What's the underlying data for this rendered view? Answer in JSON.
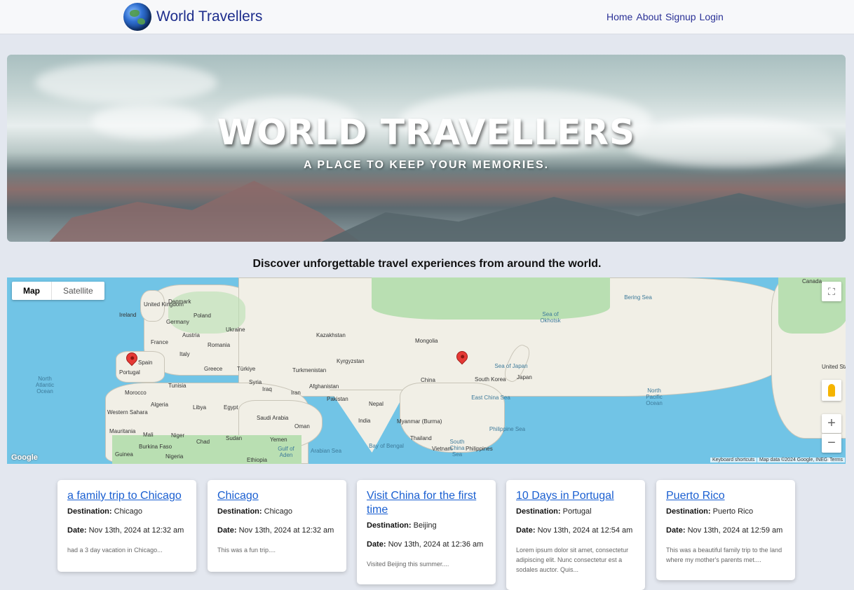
{
  "nav": {
    "brand": "World Travellers",
    "links": [
      "Home",
      "About",
      "Signup",
      "Login"
    ]
  },
  "hero": {
    "title": "WORLD TRAVELLERS",
    "subtitle": "A PLACE TO KEEP YOUR MEMORIES."
  },
  "tagline": "Discover unforgettable travel experiences from around the world.",
  "map": {
    "toggle": [
      "Map",
      "Satellite"
    ],
    "selected": "Map",
    "controls": {
      "zoom_in": "+",
      "zoom_out": "−",
      "fullscreen_icon": "fullscreen-icon",
      "pegman_icon": "pegman-icon"
    },
    "countries": [
      "United Kingdom",
      "Denmark",
      "Ireland",
      "Poland",
      "Germany",
      "Ukraine",
      "France",
      "Austria",
      "Romania",
      "Italy",
      "Spain",
      "Portugal",
      "Greece",
      "Türkiye",
      "Turkmenistan",
      "Kyrgyzstan",
      "Kazakhstan",
      "Mongolia",
      "China",
      "South Korea",
      "Japan",
      "Syria",
      "Iraq",
      "Iran",
      "Afghanistan",
      "Pakistan",
      "Nepal",
      "India",
      "Myanmar (Burma)",
      "Thailand",
      "Philippines",
      "Vietnam",
      "Tunisia",
      "Morocco",
      "Algeria",
      "Libya",
      "Egypt",
      "Saudi Arabia",
      "Oman",
      "Yemen",
      "Western Sahara",
      "Mauritania",
      "Mali",
      "Niger",
      "Chad",
      "Sudan",
      "Burkina Faso",
      "Guinea",
      "Nigeria",
      "Ethiopia",
      "Canada",
      "United States"
    ],
    "oceans": [
      "North Atlantic Ocean",
      "North Pacific Ocean",
      "Sea of Okhotsk",
      "Bering Sea",
      "Sea of Japan",
      "East China Sea",
      "Philippine Sea",
      "South China Sea",
      "Bay of Bengal",
      "Arabian Sea",
      "Gulf of Aden"
    ],
    "footer": {
      "google": "Google",
      "shortcuts": "Keyboard shortcuts",
      "data": "Map data ©2024 Google, INEGI",
      "terms": "Terms"
    }
  },
  "cards": [
    {
      "title": "a family trip to Chicago",
      "destination_label": "Destination:",
      "destination": "Chicago",
      "date_label": "Date:",
      "date": "Nov 13th, 2024 at 12:32 am",
      "desc": "had a 3 day vacation in Chicago..."
    },
    {
      "title": "Chicago",
      "destination_label": "Destination:",
      "destination": "Chicago",
      "date_label": "Date:",
      "date": "Nov 13th, 2024 at 12:32 am",
      "desc": "This was a fun trip...."
    },
    {
      "title": "Visit China for the first time",
      "destination_label": "Destination:",
      "destination": "Beijing",
      "date_label": "Date:",
      "date": "Nov 13th, 2024 at 12:36 am",
      "desc": "Visited Beijing this summer...."
    },
    {
      "title": "10 Days in Portugal",
      "destination_label": "Destination:",
      "destination": "Portugal",
      "date_label": "Date:",
      "date": "Nov 13th, 2024 at 12:54 am",
      "desc": "Lorem ipsum dolor sit amet, consectetur adipiscing elit. Nunc consectetur est a sodales auctor. Quis..."
    },
    {
      "title": "Puerto Rico",
      "destination_label": "Destination:",
      "destination": "Puerto Rico",
      "date_label": "Date:",
      "date": "Nov 13th, 2024 at 12:59 am",
      "desc": "This was a beautiful family trip to the land where my mother's parents met...."
    }
  ]
}
